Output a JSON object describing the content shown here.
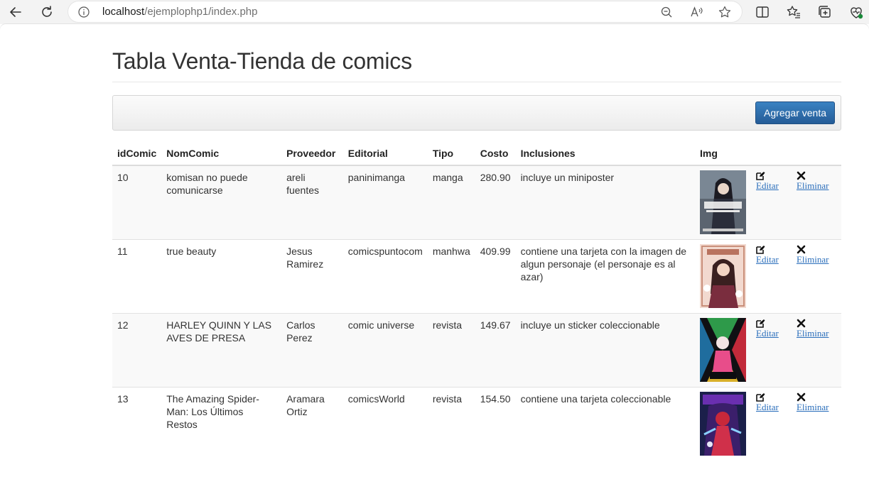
{
  "browser": {
    "url_host": "localhost",
    "url_path": "/ejemplophp1/index.php"
  },
  "page": {
    "title": "Tabla Venta-Tienda de comics",
    "add_button_label": "Agregar venta"
  },
  "table": {
    "headers": [
      "idComic",
      "NomComic",
      "Proveedor",
      "Editorial",
      "Tipo",
      "Costo",
      "Inclusiones",
      "Img"
    ],
    "rows": [
      {
        "id": "10",
        "nombre": "komisan no puede comunicarse",
        "proveedor": "areli fuentes",
        "editorial": "paninimanga",
        "tipo": "manga",
        "costo": "280.90",
        "inclusiones": "incluye un miniposter",
        "edit": "Editar",
        "delete": "Eliminar",
        "cover_icon": "komi-san-cover-image"
      },
      {
        "id": "11",
        "nombre": "true beauty",
        "proveedor": "Jesus Ramirez",
        "editorial": "comicspuntocom",
        "tipo": "manhwa",
        "costo": "409.99",
        "inclusiones": "contiene una tarjeta con la imagen de algun personaje (el personaje es al azar)",
        "edit": "Editar",
        "delete": "Eliminar",
        "cover_icon": "true-beauty-cover-image"
      },
      {
        "id": "12",
        "nombre": "HARLEY QUINN Y LAS AVES DE PRESA",
        "proveedor": "Carlos Perez",
        "editorial": "comic universe",
        "tipo": "revista",
        "costo": "149.67",
        "inclusiones": "incluye un sticker coleccionable",
        "edit": "Editar",
        "delete": "Eliminar",
        "cover_icon": "harley-quinn-cover-image"
      },
      {
        "id": "13",
        "nombre": "The Amazing Spider-Man: Los Últimos Restos",
        "proveedor": "Aramara Ortiz",
        "editorial": "comicsWorld",
        "tipo": "revista",
        "costo": "154.50",
        "inclusiones": "contiene una tarjeta coleccionable",
        "edit": "Editar",
        "delete": "Eliminar",
        "cover_icon": "spider-man-cover-image"
      }
    ]
  },
  "colors": {
    "button_primary": "#2f6fad",
    "link": "#2a6ebb",
    "striped_row": "#f9f9f9"
  }
}
